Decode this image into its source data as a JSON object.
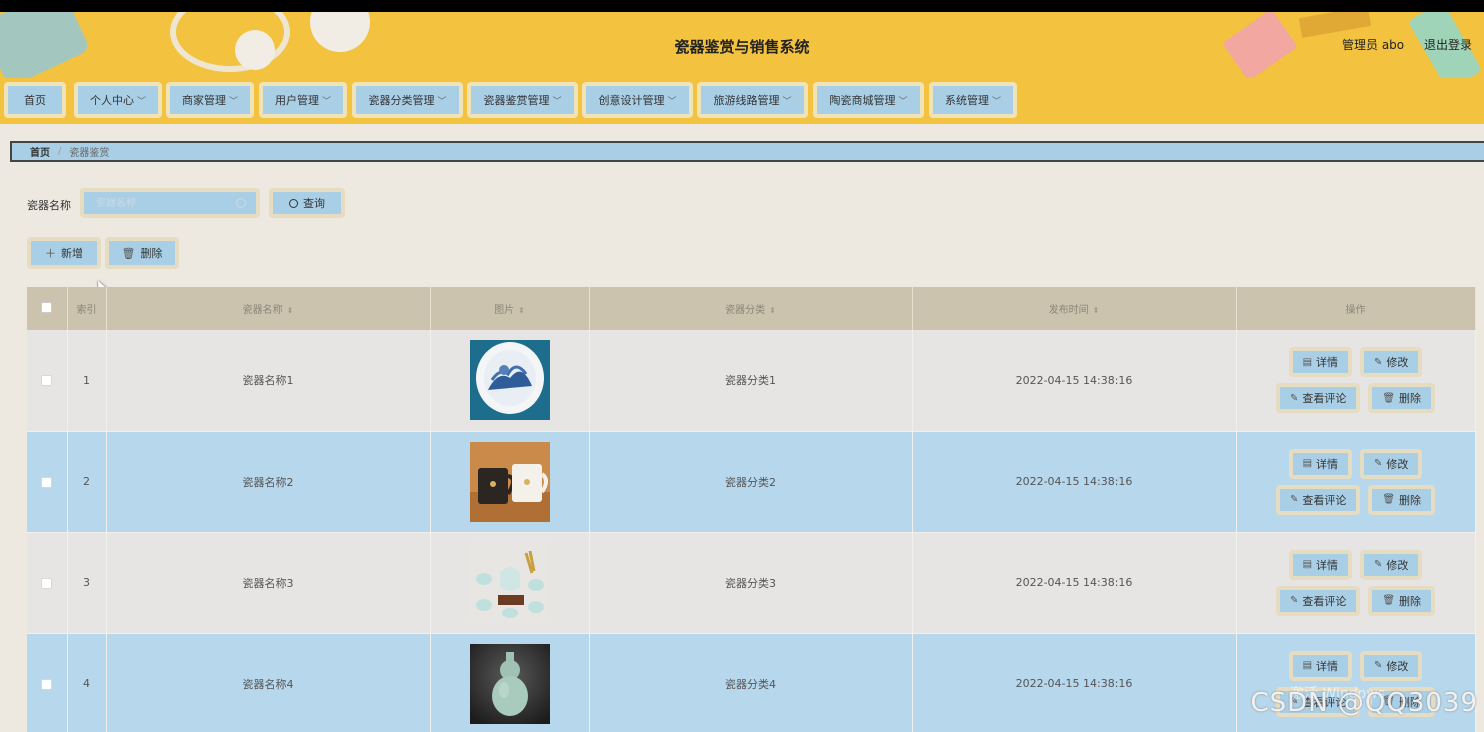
{
  "header": {
    "title": "瓷器鉴赏与销售系统",
    "user_label": "管理员 abo",
    "logout_label": "退出登录"
  },
  "nav": [
    {
      "label": "首页",
      "dropdown": false
    },
    {
      "label": "个人中心",
      "dropdown": true
    },
    {
      "label": "商家管理",
      "dropdown": true
    },
    {
      "label": "用户管理",
      "dropdown": true
    },
    {
      "label": "瓷器分类管理",
      "dropdown": true
    },
    {
      "label": "瓷器鉴赏管理",
      "dropdown": true
    },
    {
      "label": "创意设计管理",
      "dropdown": true
    },
    {
      "label": "旅游线路管理",
      "dropdown": true
    },
    {
      "label": "陶瓷商城管理",
      "dropdown": true
    },
    {
      "label": "系统管理",
      "dropdown": true
    }
  ],
  "breadcrumb": {
    "home": "首页",
    "separator": "/",
    "current": "瓷器鉴赏"
  },
  "search": {
    "label": "瓷器名称",
    "placeholder": "瓷器名称",
    "button": "查询"
  },
  "actions": {
    "add": "新增",
    "delete": "删除"
  },
  "table": {
    "columns": [
      "索引",
      "瓷器名称",
      "图片",
      "瓷器分类",
      "发布时间",
      "操作"
    ],
    "rows": [
      {
        "index": "1",
        "name": "瓷器名称1",
        "category": "瓷器分类1",
        "time": "2022-04-15 14:38:16",
        "image": "blue-white-plate"
      },
      {
        "index": "2",
        "name": "瓷器名称2",
        "category": "瓷器分类2",
        "time": "2022-04-15 14:38:16",
        "image": "mugs"
      },
      {
        "index": "3",
        "name": "瓷器名称3",
        "category": "瓷器分类3",
        "time": "2022-04-15 14:38:16",
        "image": "tea-set"
      },
      {
        "index": "4",
        "name": "瓷器名称4",
        "category": "瓷器分类4",
        "time": "2022-04-15 14:38:16",
        "image": "gourd-vase"
      }
    ],
    "row_buttons": {
      "detail": "详情",
      "edit": "修改",
      "comments": "查看评论",
      "delete": "删除"
    }
  },
  "watermark": {
    "text": "CSDN @QQ3039",
    "activate": "激活 Windows"
  },
  "colors": {
    "header": "#f3c23e",
    "button": "#a9cfe6",
    "button_border": "#e6dcc2",
    "row_alt": "#b6d7ec",
    "page_bg": "#ede8e0"
  }
}
